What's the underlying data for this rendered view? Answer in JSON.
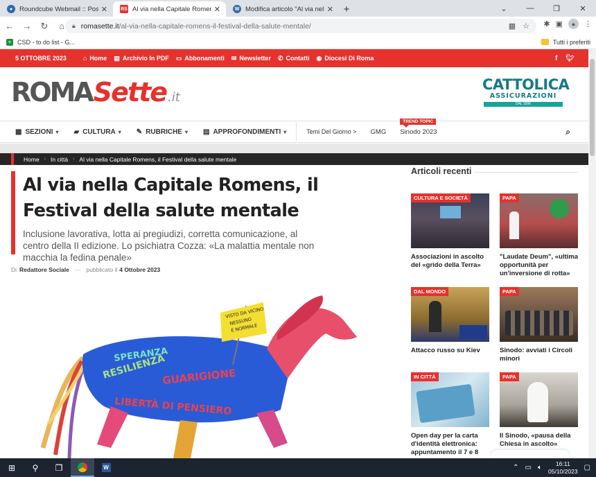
{
  "browser": {
    "tabs": [
      {
        "title": "Roundcube Webmail :: Posta in a",
        "favicon": "roundcube-icon",
        "active": false
      },
      {
        "title": "Al via nella Capitale Romens, il F",
        "favicon": "romasette-icon",
        "active": true
      },
      {
        "title": "Modifica articolo \"Al via nella Ca",
        "favicon": "wordpress-icon",
        "active": false
      }
    ],
    "url_host": "romasette.it",
    "url_path": "/al-via-nella-capitale-romens-il-festival-della-salute-mentale/",
    "bookmarks": [
      {
        "label": "CSD - to do list - G..."
      }
    ],
    "bookmarks_right": "Tutti i preferiti"
  },
  "site": {
    "topbar": {
      "date": "5 OTTOBRE 2023",
      "links": [
        {
          "label": "Home",
          "icon": "home-icon"
        },
        {
          "label": "Archivio In PDF",
          "icon": "pdf-icon"
        },
        {
          "label": "Abbonamenti",
          "icon": "document-icon"
        },
        {
          "label": "Newsletter",
          "icon": "mail-icon"
        },
        {
          "label": "Contatti",
          "icon": "phone-icon"
        },
        {
          "label": "Diocesi Di Roma",
          "icon": "globe-icon"
        }
      ]
    },
    "logo": {
      "part1": "ROMA",
      "part2": "Sette",
      "part3": ".it"
    },
    "sponsor": {
      "line1": "CATTOLICA",
      "line2": "ASSICURAZIONI",
      "line3": "DAL 1896"
    },
    "nav": {
      "items": [
        {
          "label": "SEZIONI",
          "icon": "newspaper-icon",
          "dropdown": true
        },
        {
          "label": "CULTURA",
          "icon": "book-icon",
          "dropdown": true
        },
        {
          "label": "RUBRICHE",
          "icon": "pen-icon",
          "dropdown": true
        },
        {
          "label": "APPROFONDIMENTI",
          "icon": "document-icon",
          "dropdown": true
        }
      ],
      "sub_label": "Temi Del Giorno >",
      "topics": [
        "GMG",
        "Sinodo 2023"
      ],
      "trend_badge": "TREND TOPIC"
    },
    "breadcrumb": [
      "Home",
      "In città",
      "Al via nella Capitale Romens, il Festival della salute mentale"
    ]
  },
  "article": {
    "title": "Al via nella Capitale Romens, il Festival della salute mentale",
    "subtitle": "Inclusione lavorativa, lotta ai pregiudizi, corretta comunicazione, al centro della II edizione. Lo psichiatra Cozza: «La malattia mentale non macchia la fedina penale»",
    "by_prefix": "Di",
    "author": "Redattore Sociale",
    "published_prefix": "pubblicato il",
    "published_date": "4 Ottobre 2023",
    "hero_words": [
      "SPERANZA",
      "RESILIENZA",
      "GUARIGIONE",
      "LIBERTÀ DI PENSIERO"
    ],
    "flag_words": [
      "VISTO DA VICINO",
      "NESSUNO",
      "È NORMALE"
    ]
  },
  "sidebar": {
    "title": "Articoli recenti",
    "cards": [
      {
        "category": "CULTURA E SOCIETÀ",
        "title": "Associazioni in ascolto del «grido della Terra»"
      },
      {
        "category": "PAPA",
        "title": "\"Laudate Deum\", «ultima opportunità per un'inversione di rotta»"
      },
      {
        "category": "DAL MONDO",
        "title": "Attacco russo su Kiev"
      },
      {
        "category": "PAPA",
        "title": "Sinodo: avviati i Circoli minori"
      },
      {
        "category": "IN CITTÀ",
        "title": "Open day per la carta d'identità elettronica: appuntamento il 7 e 8"
      },
      {
        "category": "PAPA",
        "title": "Il Sinodo, «pausa della Chiesa in ascolto»"
      }
    ]
  },
  "taskbar": {
    "time": "16:11",
    "date": "05/10/2023"
  },
  "colors": {
    "brand_red": "#e5322d",
    "dark": "#262626",
    "sponsor_teal": "#157b87"
  }
}
